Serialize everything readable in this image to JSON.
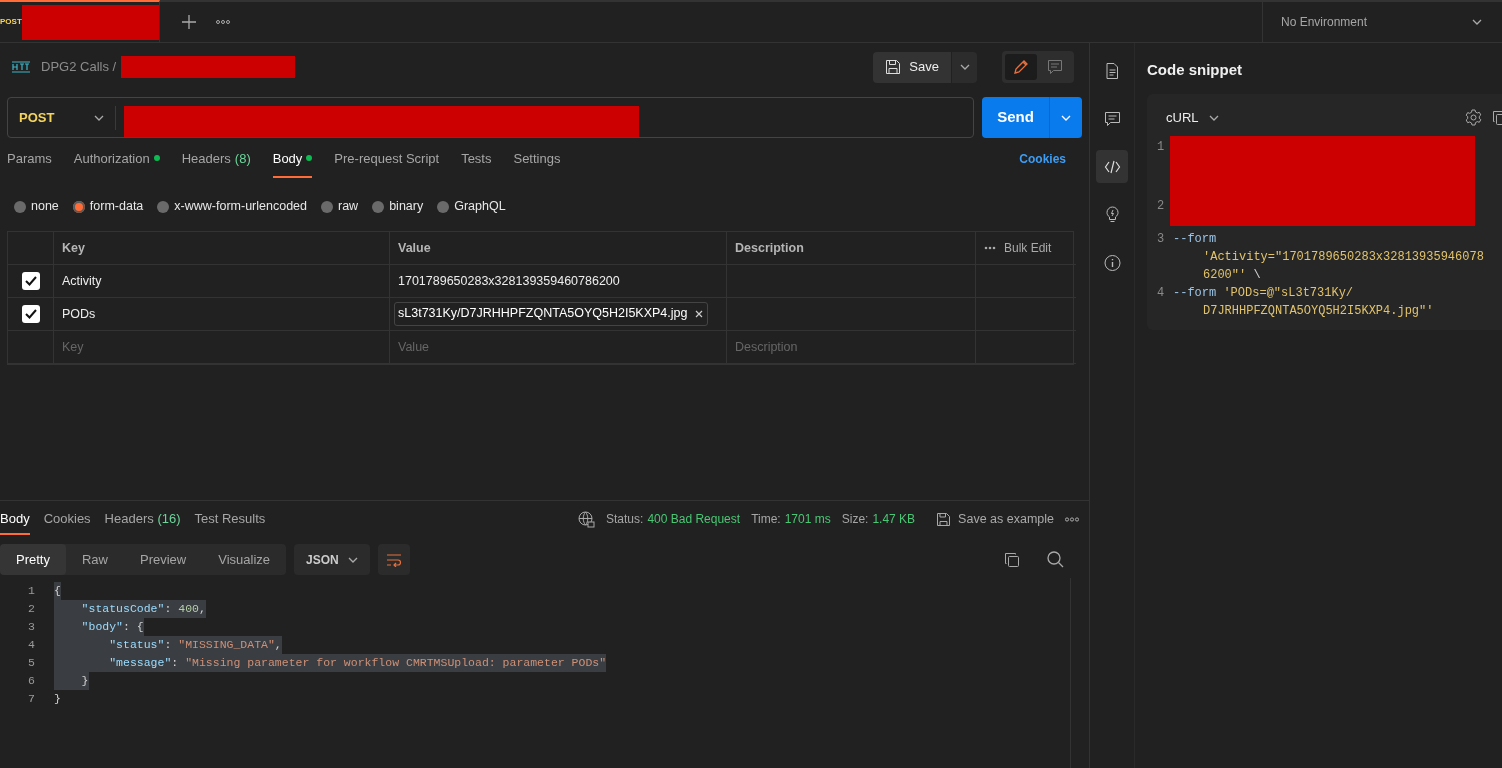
{
  "top_tabs": [
    {
      "method": "POST",
      "selected": true,
      "redacted": true
    }
  ],
  "environment": {
    "label": "No Environment"
  },
  "breadcrumb": {
    "collection": "DPG2 Calls",
    "separator": "/",
    "redacted": true
  },
  "save_button": {
    "label": "Save"
  },
  "mode_toggle": [
    {
      "kind": "edit",
      "selected": true
    },
    {
      "kind": "comment",
      "selected": false
    }
  ],
  "request": {
    "method": "POST",
    "url_redacted": true
  },
  "send_button": {
    "label": "Send"
  },
  "request_tabs": [
    {
      "label": "Params",
      "selected": false,
      "dot": false
    },
    {
      "label": "Authorization",
      "selected": false,
      "dot": true
    },
    {
      "label": "Headers",
      "count": "(8)",
      "selected": false,
      "dot": false
    },
    {
      "label": "Body",
      "selected": true,
      "dot": true
    },
    {
      "label": "Pre-request Script",
      "selected": false,
      "dot": false
    },
    {
      "label": "Tests",
      "selected": false,
      "dot": false
    },
    {
      "label": "Settings",
      "selected": false,
      "dot": false
    }
  ],
  "cookies_link": "Cookies",
  "body_types": [
    {
      "label": "none",
      "selected": false
    },
    {
      "label": "form-data",
      "selected": true
    },
    {
      "label": "x-www-form-urlencoded",
      "selected": false
    },
    {
      "label": "raw",
      "selected": false
    },
    {
      "label": "binary",
      "selected": false
    },
    {
      "label": "GraphQL",
      "selected": false
    }
  ],
  "params_table": {
    "columns": [
      "Key",
      "Value",
      "Description"
    ],
    "bulk_edit": "Bulk Edit",
    "rows": [
      {
        "checked": true,
        "key": "Activity",
        "kind": "text",
        "value": "1701789650283x328139359460786200"
      },
      {
        "checked": true,
        "key": "PODs",
        "kind": "file",
        "value": "sL3t731Ky/D7JRHHPFZQNTA5OYQ5H2I5KXP4.jpg"
      }
    ],
    "placeholders": {
      "key": "Key",
      "value": "Value",
      "description": "Description"
    }
  },
  "response": {
    "tabs": [
      {
        "label": "Body",
        "selected": true
      },
      {
        "label": "Cookies",
        "selected": false
      },
      {
        "label": "Headers",
        "count": "(16)",
        "selected": false
      },
      {
        "label": "Test Results",
        "selected": false
      }
    ],
    "status": {
      "label": "Status:",
      "value": "400 Bad Request"
    },
    "time": {
      "label": "Time:",
      "value": "1701 ms"
    },
    "size": {
      "label": "Size:",
      "value": "1.47 KB"
    },
    "save_example": "Save as example",
    "view_modes": [
      {
        "label": "Pretty",
        "selected": true
      },
      {
        "label": "Raw",
        "selected": false
      },
      {
        "label": "Preview",
        "selected": false
      },
      {
        "label": "Visualize",
        "selected": false
      }
    ],
    "format": "JSON",
    "lines": [
      {
        "number": "1",
        "selected": true,
        "tokens": [
          {
            "kind": "punct",
            "text": "{"
          }
        ]
      },
      {
        "number": "2",
        "selected": true,
        "tokens": [
          {
            "kind": "key",
            "text": "    \"statusCode\""
          },
          {
            "kind": "punct",
            "text": ": "
          },
          {
            "kind": "number",
            "text": "400"
          },
          {
            "kind": "punct",
            "text": ","
          }
        ]
      },
      {
        "number": "3",
        "selected": true,
        "tokens": [
          {
            "kind": "key",
            "text": "    \"body\""
          },
          {
            "kind": "punct",
            "text": ": {"
          }
        ]
      },
      {
        "number": "4",
        "selected": true,
        "tokens": [
          {
            "kind": "key",
            "text": "        \"status\""
          },
          {
            "kind": "punct",
            "text": ": "
          },
          {
            "kind": "string",
            "text": "\"MISSING_DATA\""
          },
          {
            "kind": "punct",
            "text": ","
          }
        ]
      },
      {
        "number": "5",
        "selected": true,
        "tokens": [
          {
            "kind": "key",
            "text": "        \"message\""
          },
          {
            "kind": "punct",
            "text": ": "
          },
          {
            "kind": "string",
            "text": "\"Missing parameter for workflow CMRTMSUpload: parameter PODs\""
          }
        ]
      },
      {
        "number": "6",
        "selected": true,
        "tokens": [
          {
            "kind": "punct",
            "text": "    }"
          }
        ]
      },
      {
        "number": "7",
        "selected": false,
        "tokens": [
          {
            "kind": "punct",
            "text": "}"
          }
        ]
      }
    ]
  },
  "side_icons": [
    {
      "kind": "document",
      "selected": false
    },
    {
      "kind": "comment",
      "selected": false
    },
    {
      "kind": "code",
      "selected": true
    },
    {
      "kind": "bulb",
      "selected": false
    },
    {
      "kind": "info",
      "selected": false
    }
  ],
  "code_snippet": {
    "title": "Code snippet",
    "language": "cURL",
    "lines": [
      {
        "number": "1",
        "redacted": true
      },
      {
        "number": "2",
        "redacted": true
      },
      {
        "number": "3",
        "redacted": false,
        "rows": [
          [
            {
              "kind": "flag",
              "text": "--form"
            }
          ],
          [
            {
              "kind": "string",
              "text": "'Activity=\"1701789650283x32813935946078"
            }
          ],
          [
            {
              "kind": "string",
              "text": "6200\"'"
            },
            {
              "kind": "plain",
              "text": " \\"
            }
          ]
        ]
      },
      {
        "number": "4",
        "redacted": false,
        "rows": [
          [
            {
              "kind": "flag",
              "text": "--form"
            },
            {
              "kind": "plain",
              "text": " "
            },
            {
              "kind": "string",
              "text": "'PODs=@\"sL3t731Ky/"
            }
          ],
          [
            {
              "kind": "string",
              "text": "D7JRHHPFZQNTA5OYQ5H2I5KXP4.jpg\"'"
            }
          ]
        ]
      }
    ]
  }
}
